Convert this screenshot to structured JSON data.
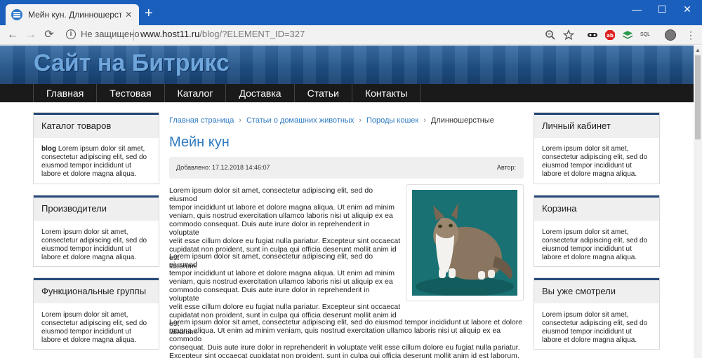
{
  "browser": {
    "tab_title": "Мейн кун. Длинношерстные. Ст",
    "tab_close": "✕",
    "new_tab": "+",
    "window_controls": [
      "—",
      "☐",
      "✕"
    ],
    "nav_icons": [
      "back-icon",
      "forward-icon",
      "reload-icon",
      "info-icon"
    ],
    "nav_glyphs": [
      "←",
      "→",
      "⟳",
      "i"
    ],
    "security_text": "Не защищено",
    "url_host": "www.host11.ru",
    "url_rest": "/blog/?ELEMENT_ID=327",
    "toolbar_icons": [
      "zoom-icon",
      "bookmark-star-icon",
      "mask-extension-icon",
      "adblock-extension-icon",
      "layers-extension-icon",
      "sql-extension-icon",
      "profile-avatar",
      "menu-icon"
    ],
    "sql_label": "SQL",
    "colors": {
      "tabbar": "#1b5fbd",
      "toolbar": "#f2f2f2"
    }
  },
  "site": {
    "title": "Сайт на Битрикс",
    "menu": [
      "Главная",
      "Тестовая",
      "Каталог",
      "Доставка",
      "Статьи",
      "Контакты"
    ],
    "colors": {
      "link": "#2f7ac1",
      "menubar": "#1a1a1a",
      "widget_accent": "#254a7a"
    }
  },
  "left_sidebar": [
    {
      "title": "Каталог товаров",
      "bold": "blog",
      "text": " Lorem ipsum dolor sit amet, consectetur adipiscing elit, sed do eiusmod tempor incididunt ut labore et dolore magna aliqua."
    },
    {
      "title": "Производители",
      "bold": "",
      "text": "Lorem ipsum dolor sit amet, consectetur adipiscing elit, sed do eiusmod tempor incididunt ut labore et dolore magna aliqua."
    },
    {
      "title": "Функциональные группы",
      "bold": "",
      "text": "Lorem ipsum dolor sit amet, consectetur adipiscing elit, sed do eiusmod tempor incididunt ut labore et dolore magna aliqua."
    }
  ],
  "right_sidebar": [
    {
      "title": "Личный кабинет",
      "text": "Lorem ipsum dolor sit amet, consectetur adipiscing elit, sed do eiusmod tempor incididunt ut labore et dolore magna aliqua."
    },
    {
      "title": "Корзина",
      "text": "Lorem ipsum dolor sit amet, consectetur adipiscing elit, sed do eiusmod tempor incididunt ut labore et dolore magna aliqua."
    },
    {
      "title": "Вы уже смотрели",
      "text": "Lorem ipsum dolor sit amet, consectetur adipiscing elit, sed do eiusmod tempor incididunt ut labore et dolore magna aliqua."
    }
  ],
  "article": {
    "breadcrumb": [
      "Главная страница",
      "Статьи о домашних животных",
      "Породы кошек"
    ],
    "breadcrumb_sep": "›",
    "breadcrumb_current": "Длинношерстные",
    "title": "Мейн кун",
    "date": "Добавлено: 17.12.2018 14:46:07",
    "author": "Автор:",
    "paragraphs": [
      [
        "Lorem ipsum dolor sit amet, consectetur adipiscing elit, sed do eiusmod",
        "tempor incididunt ut labore et dolore magna aliqua. Ut enim ad minim",
        "veniam, quis nostrud exercitation ullamco laboris nisi ut aliquip ex ea",
        "commodo consequat. Duis aute irure dolor in reprehenderit in voluptate",
        "velit esse cillum dolore eu fugiat nulla pariatur. Excepteur sint occaecat",
        "cupidatat non proident, sunt in culpa qui officia deserunt mollit anim id est",
        "laborum."
      ],
      [
        "Lorem ipsum dolor sit amet, consectetur adipiscing elit, sed do eiusmod",
        "tempor incididunt ut labore et dolore magna aliqua. Ut enim ad minim",
        "veniam, quis nostrud exercitation ullamco laboris nisi ut aliquip ex ea",
        "commodo consequat. Duis aute irure dolor in reprehenderit in voluptate",
        "velit esse cillum dolore eu fugiat nulla pariatur. Excepteur sint occaecat",
        "cupidatat non proident, sunt in culpa qui officia deserunt mollit anim id est",
        "laborum."
      ],
      [
        "Lorem ipsum dolor sit amet, consectetur adipiscing elit, sed do eiusmod tempor incididunt ut labore et dolore",
        "magna aliqua. Ut enim ad minim veniam, quis nostrud exercitation ullamco laboris nisi ut aliquip ex ea commodo",
        "consequat. Duis aute irure dolor in reprehenderit in voluptate velit esse cillum dolore eu fugiat nulla pariatur.",
        "Excepteur sint occaecat cupidatat non proident, sunt in culpa qui officia deserunt mollit anim id est laborum."
      ]
    ]
  }
}
